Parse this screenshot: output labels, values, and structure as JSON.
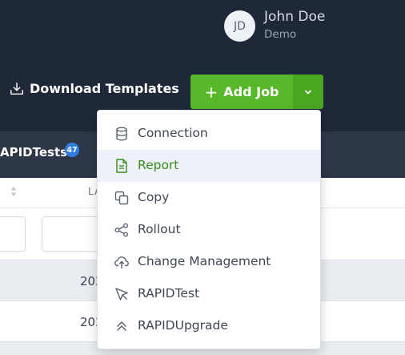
{
  "user": {
    "initials": "JD",
    "name": "John Doe",
    "subtitle": "Demo"
  },
  "toolbar": {
    "download_label": "Download Templates",
    "add_job_label": "Add Job",
    "add_job_plus": "+"
  },
  "tabs": {
    "label": "APIDTests",
    "badge": "47"
  },
  "table": {
    "column_partial": "LA",
    "rows": [
      {
        "date": "202"
      },
      {
        "date": "202"
      }
    ]
  },
  "menu": {
    "items": [
      {
        "label": "Connection",
        "icon": "database-icon"
      },
      {
        "label": "Report",
        "icon": "document-icon",
        "active": true
      },
      {
        "label": "Copy",
        "icon": "copy-icon"
      },
      {
        "label": "Rollout",
        "icon": "share-icon"
      },
      {
        "label": "Change Management",
        "icon": "cloud-upload-icon"
      },
      {
        "label": "RAPIDTest",
        "icon": "cursor-icon"
      },
      {
        "label": "RAPIDUpgrade",
        "icon": "double-chevron-up-icon"
      }
    ]
  },
  "colors": {
    "topbar": "#1f2838",
    "accent_green": "#58b82a",
    "active_text": "#3a8a1e",
    "badge_blue": "#2f7de1"
  }
}
